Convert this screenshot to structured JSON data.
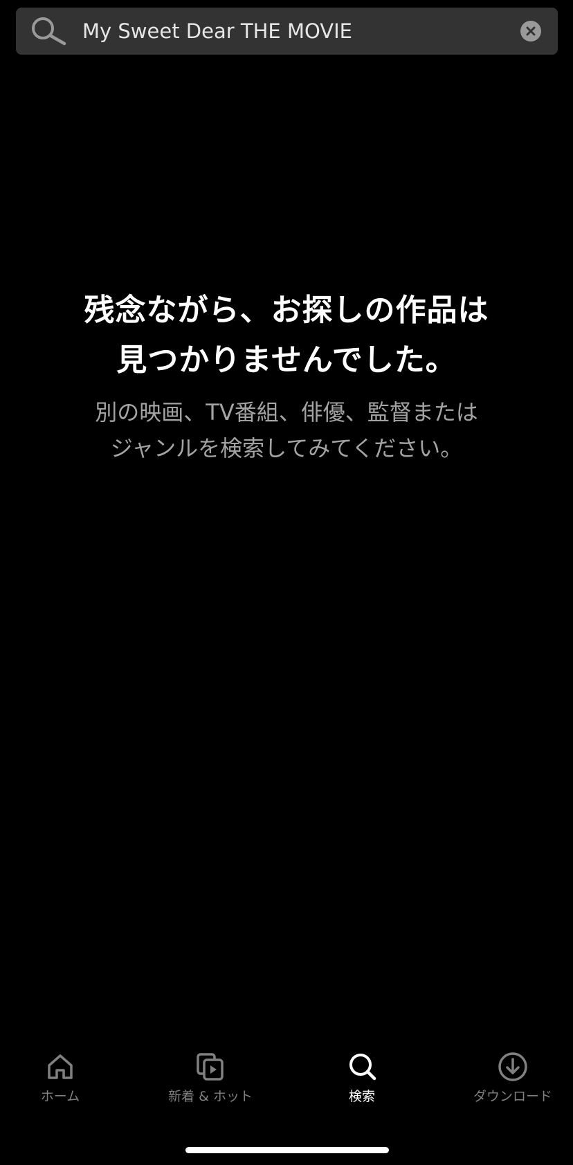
{
  "search": {
    "query": "My Sweet Dear THE MOVIE",
    "search_icon": "search-icon",
    "clear_icon": "clear-icon"
  },
  "empty_state": {
    "headline_line1": "残念ながら、お探しの作品は",
    "headline_line2": "見つかりませんでした。",
    "subtext_line1": "別の映画、TV番組、俳優、監督または",
    "subtext_line2": "ジャンルを検索してみてください。"
  },
  "bottom_nav": {
    "items": [
      {
        "label": "ホーム",
        "icon": "home-icon",
        "active": false
      },
      {
        "label": "新着 & ホット",
        "icon": "new-hot-icon",
        "active": false
      },
      {
        "label": "検索",
        "icon": "search-icon",
        "active": true
      },
      {
        "label": "ダウンロード",
        "icon": "download-icon",
        "active": false
      }
    ]
  },
  "colors": {
    "background": "#000000",
    "search_bar": "#333333",
    "inactive": "#808080",
    "active": "#ffffff",
    "subtext": "#a3a3a3"
  }
}
